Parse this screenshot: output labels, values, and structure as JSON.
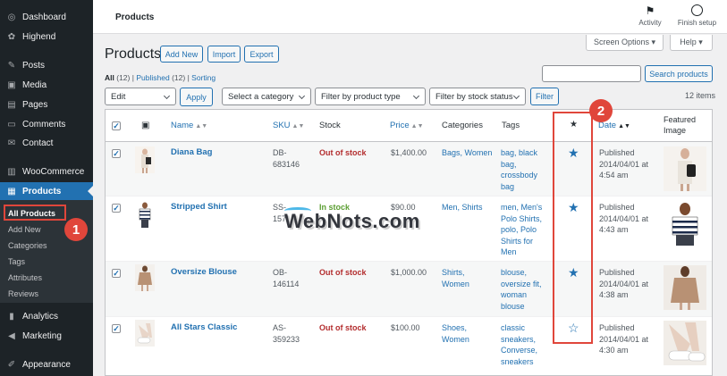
{
  "sidebar": {
    "items": [
      {
        "label": "Dashboard",
        "icon": "dashboard-icon",
        "glyph": "◎"
      },
      {
        "label": "Highend",
        "icon": "palette-icon",
        "glyph": "✿"
      },
      {
        "label": "Posts",
        "icon": "pin-icon",
        "glyph": "✎"
      },
      {
        "label": "Media",
        "icon": "media-icon",
        "glyph": "▣"
      },
      {
        "label": "Pages",
        "icon": "page-icon",
        "glyph": "▤"
      },
      {
        "label": "Comments",
        "icon": "comment-icon",
        "glyph": "▭"
      },
      {
        "label": "Contact",
        "icon": "mail-icon",
        "glyph": "✉"
      },
      {
        "label": "WooCommerce",
        "icon": "woo-icon",
        "glyph": "▥"
      },
      {
        "label": "Products",
        "icon": "archive-icon",
        "glyph": "▦"
      },
      {
        "label": "Analytics",
        "icon": "chart-icon",
        "glyph": "▮"
      },
      {
        "label": "Marketing",
        "icon": "megaphone-icon",
        "glyph": "◀"
      },
      {
        "label": "Appearance",
        "icon": "brush-icon",
        "glyph": "✐"
      }
    ],
    "submenu": [
      "All Products",
      "Add New",
      "Categories",
      "Tags",
      "Attributes",
      "Reviews"
    ]
  },
  "annotations": {
    "badge1": "1",
    "badge2": "2"
  },
  "topbar": {
    "title": "Products",
    "activity": "Activity",
    "finish_setup": "Finish setup"
  },
  "screen_options": "Screen Options ▾",
  "help": "Help ▾",
  "page": {
    "title": "Products",
    "add_new": "Add New",
    "import": "Import",
    "export": "Export"
  },
  "views": {
    "all": "All",
    "all_count": "(12)",
    "published": "Published",
    "published_count": "(12)",
    "sorting": "Sorting",
    "sep": "|"
  },
  "search": {
    "button": "Search products"
  },
  "filters": {
    "bulk": "Edit",
    "apply": "Apply",
    "category": "Select a category",
    "product_type": "Filter by product type",
    "stock_status": "Filter by stock status",
    "filter": "Filter"
  },
  "items_count": "12 items",
  "table": {
    "headers": {
      "name": "Name",
      "sku": "SKU",
      "stock": "Stock",
      "price": "Price",
      "categories": "Categories",
      "tags": "Tags",
      "featured_star": "★",
      "date": "Date",
      "featured_image_1": "Featured",
      "featured_image_2": "Image"
    },
    "rows": [
      {
        "name": "Diana Bag",
        "sku": [
          "DB-",
          "683146"
        ],
        "stock": "Out of stock",
        "stock_status": "out",
        "price": "$1,400.00",
        "categories": [
          "Bags, Women"
        ],
        "tags": [
          "bag, black",
          "bag,",
          "crossbody",
          "bag"
        ],
        "featured": true,
        "date": [
          "Published",
          "2014/04/01 at",
          "4:54 am"
        ]
      },
      {
        "name": "Stripped Shirt",
        "sku": [
          "SS-",
          "157"
        ],
        "stock": "In stock",
        "stock_status": "in",
        "price": "$90.00",
        "categories": [
          "Men, Shirts"
        ],
        "tags": [
          "men, Men's",
          "Polo Shirts,",
          "polo, Polo",
          "Shirts for",
          "Men"
        ],
        "featured": true,
        "date": [
          "Published",
          "2014/04/01 at",
          "4:43 am"
        ]
      },
      {
        "name": "Oversize Blouse",
        "sku": [
          "OB-",
          "146114"
        ],
        "stock": "Out of stock",
        "stock_status": "out",
        "price": "$1,000.00",
        "categories": [
          "Shirts,",
          "Women"
        ],
        "tags": [
          "blouse,",
          "oversize fit,",
          "woman",
          "blouse"
        ],
        "featured": true,
        "date": [
          "Published",
          "2014/04/01 at",
          "4:38 am"
        ]
      },
      {
        "name": "All Stars Classic",
        "sku": [
          "AS-",
          "359233"
        ],
        "stock": "Out of stock",
        "stock_status": "out",
        "price": "$100.00",
        "categories": [
          "Shoes,",
          "Women"
        ],
        "tags": [
          "classic",
          "sneakers,",
          "Converse,",
          "sneakers"
        ],
        "featured": false,
        "date": [
          "Published",
          "2014/04/01 at",
          "4:30 am"
        ]
      }
    ]
  },
  "watermark": "WebNots.com",
  "colors": {
    "accent": "#2271b1",
    "sidebar": "#1d2327",
    "highlight": "#e0463b",
    "in_stock": "#5b9e32",
    "out_of_stock": "#b32d2e"
  }
}
